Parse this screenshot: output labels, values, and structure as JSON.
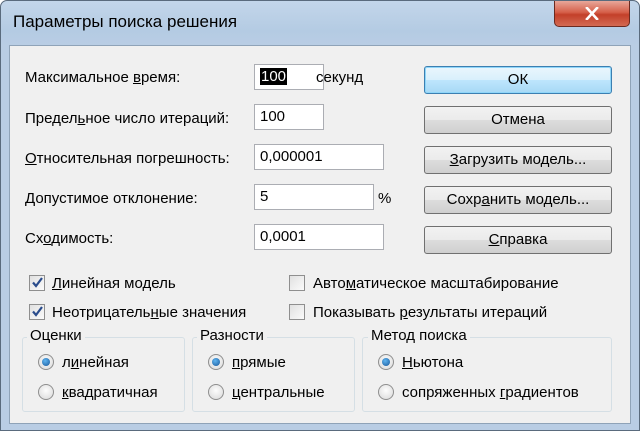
{
  "window": {
    "title": "Параметры поиска решения"
  },
  "fields": {
    "max_time": {
      "label_pre": "Максимальное ",
      "label_u": "в",
      "label_post": "ремя:",
      "value": "100",
      "unit": "секунд"
    },
    "iterations": {
      "label_pre": "Предел",
      "label_u": "ь",
      "label_post": "ное число итераций:",
      "value": "100"
    },
    "precision": {
      "label_pre": "",
      "label_u": "О",
      "label_post": "тносительная погрешность:",
      "value": "0,000001"
    },
    "tolerance": {
      "label_pre": "Допустимое отклонение:",
      "label_u": "",
      "label_post": "",
      "value": "5",
      "unit": "%"
    },
    "convergence": {
      "label_pre": "Сх",
      "label_u": "о",
      "label_post": "димость:",
      "value": "0,0001"
    }
  },
  "buttons": {
    "ok": "ОК",
    "cancel": "Отмена",
    "load_pre": "",
    "load_u": "З",
    "load_post": "агрузить модель...",
    "save_pre": "Сохр",
    "save_u": "а",
    "save_post": "нить модель...",
    "help_pre": "",
    "help_u": "С",
    "help_post": "правка"
  },
  "options": {
    "linear_model": {
      "pre": "",
      "u": "Л",
      "post": "инейная модель",
      "checked": true
    },
    "non_negative": {
      "pre": "Неотрицатель",
      "u": "н",
      "post": "ые значения",
      "checked": true
    },
    "auto_scale": {
      "pre": "Авто",
      "u": "м",
      "post": "атическое масштабирование",
      "checked": false
    },
    "show_iterations": {
      "pre": "Показывать ",
      "u": "р",
      "post": "езультаты итераций",
      "checked": false
    }
  },
  "groups": {
    "estimates": {
      "title": "Оценки",
      "opt1_pre": "л",
      "opt1_u": "и",
      "opt1_post": "нейная",
      "opt2_pre": "",
      "opt2_u": "к",
      "opt2_post": "вадратичная",
      "selected": 1
    },
    "derivatives": {
      "title": "Разности",
      "opt1_pre": "",
      "opt1_u": "п",
      "opt1_post": "рямые",
      "opt2_pre": "",
      "opt2_u": "ц",
      "opt2_post": "ентральные",
      "selected": 1
    },
    "search": {
      "title": "Метод поиска",
      "opt1_pre": "",
      "opt1_u": "Н",
      "opt1_post": "ьютона",
      "opt2_pre": "сопряженных ",
      "opt2_u": "г",
      "opt2_post": "радиентов",
      "selected": 1
    }
  }
}
